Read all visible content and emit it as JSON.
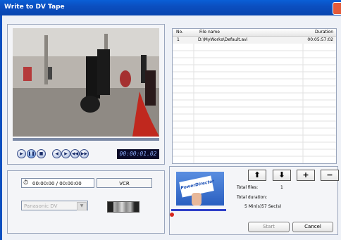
{
  "window": {
    "title": "Write to DV Tape"
  },
  "player": {
    "time_readout": "00:00:01.02",
    "controls": [
      "play",
      "pause",
      "stop",
      "previous-frame",
      "next-frame",
      "rewind",
      "fast-forward"
    ]
  },
  "device": {
    "duration_text": "00:00:00 / 00:00:00",
    "mode_label": "VCR",
    "device_select": "Panasonic DV"
  },
  "file_table": {
    "headers": {
      "no": "No.",
      "file_name": "File name",
      "duration": "Duration"
    },
    "rows": [
      {
        "no": "1",
        "file_name": "D:\\MyWorks\\Default.avi",
        "duration": "00:05:57:02"
      }
    ]
  },
  "summary": {
    "thumbnail_text": "PowerDirector",
    "total_files_label": "Total files:",
    "total_files_value": "1",
    "total_duration_label": "Total duration:",
    "total_duration_value": "5 Min(s)57 Sec(s)"
  },
  "buttons": {
    "start": "Start",
    "cancel": "Cancel",
    "move_up": "⬆",
    "move_down": "⬇",
    "add": "+",
    "remove": "−"
  }
}
